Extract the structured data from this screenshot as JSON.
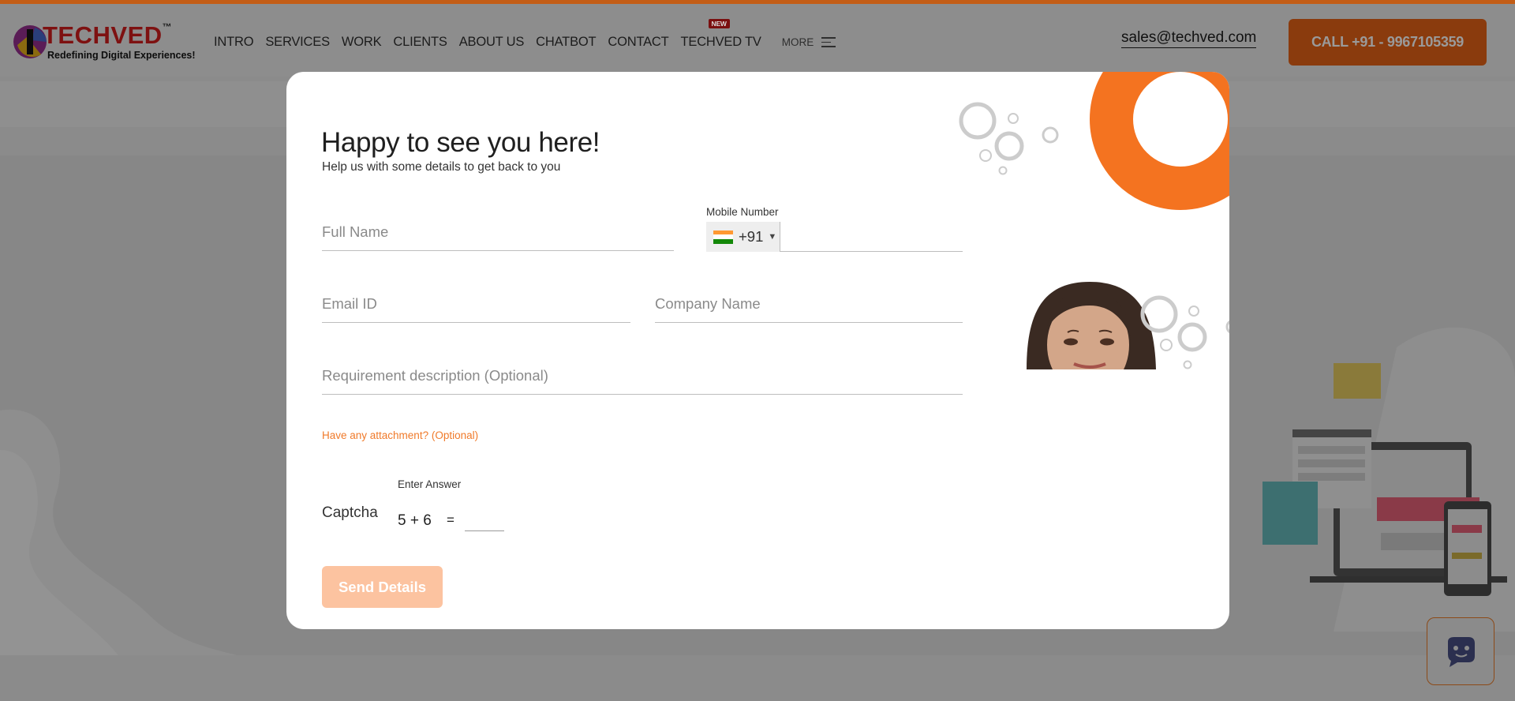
{
  "header": {
    "logo_text": "TECHVED",
    "logo_tm": "™",
    "logo_tagline": "Redefining Digital Experiences!",
    "nav": [
      {
        "label": "INTRO"
      },
      {
        "label": "SERVICES"
      },
      {
        "label": "WORK"
      },
      {
        "label": "CLIENTS"
      },
      {
        "label": "ABOUT US"
      },
      {
        "label": "CHATBOT"
      },
      {
        "label": "CONTACT"
      },
      {
        "label": "TECHVED TV",
        "badge": "NEW"
      }
    ],
    "more_label": "MORE",
    "email": "sales@techved.com",
    "call_label": "CALL +91 - 9967105359"
  },
  "modal": {
    "title": "Happy to see you here!",
    "subtitle": "Help us with some details to get back to you",
    "fields": {
      "full_name": {
        "placeholder": "Full Name",
        "value": ""
      },
      "mobile": {
        "label": "Mobile Number",
        "country_code": "+91",
        "value": ""
      },
      "email": {
        "placeholder": "Email ID",
        "value": ""
      },
      "company": {
        "placeholder": "Company Name",
        "value": ""
      },
      "requirement": {
        "placeholder": "Requirement description (Optional)",
        "value": ""
      }
    },
    "attachment_label": "Have any attachment? (Optional)",
    "captcha": {
      "label": "Captcha",
      "answer_label": "Enter Answer",
      "question": "5 + 6",
      "equals": "=",
      "answer": ""
    },
    "submit_label": "Send Details"
  },
  "colors": {
    "accent": "#f47320",
    "submit_disabled": "#fcc3a0",
    "link": "#f07a2a"
  },
  "icons": [
    "menu-icon",
    "india-flag-icon",
    "chevron-down-icon",
    "chatbot-icon"
  ]
}
